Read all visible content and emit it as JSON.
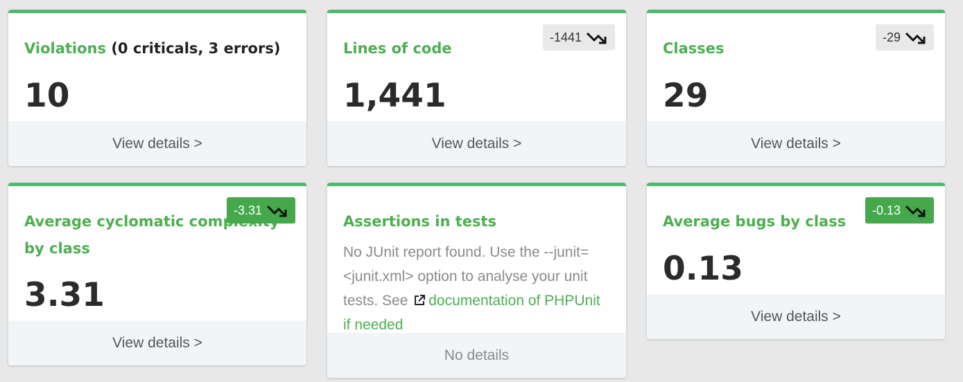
{
  "cards": [
    {
      "title": "Violations",
      "title_sub": "(0 criticals, 3 errors)",
      "value": "10",
      "footer": "View details >"
    },
    {
      "title": "Lines of code",
      "value": "1,441",
      "badge": "-1441",
      "badge_icon": "trend-down-icon",
      "footer": "View details >"
    },
    {
      "title": "Classes",
      "value": "29",
      "badge": "-29",
      "badge_icon": "trend-down-icon",
      "footer": "View details >"
    },
    {
      "title": "Average cyclomatic complexity by class",
      "value": "3.31",
      "badge": "-3.31",
      "badge_icon": "trend-down-icon",
      "footer": "View details >"
    },
    {
      "title": "Assertions in tests",
      "desc_text": "No JUnit report found. Use the --junit=<junit.xml> option to analyse your unit tests. See",
      "desc_link": "documentation of PHPUnit if needed",
      "desc_link_icon": "external-link-icon",
      "footer": "No details"
    },
    {
      "title": "Average bugs by class",
      "value": "0.13",
      "badge": "-0.13",
      "badge_icon": "trend-down-icon",
      "footer": "View details >"
    }
  ],
  "colors": {
    "accent": "#4caf50",
    "badge_green": "#45a84b",
    "badge_gray": "#e9e9e9",
    "footer_bg": "#f2f5f8"
  }
}
